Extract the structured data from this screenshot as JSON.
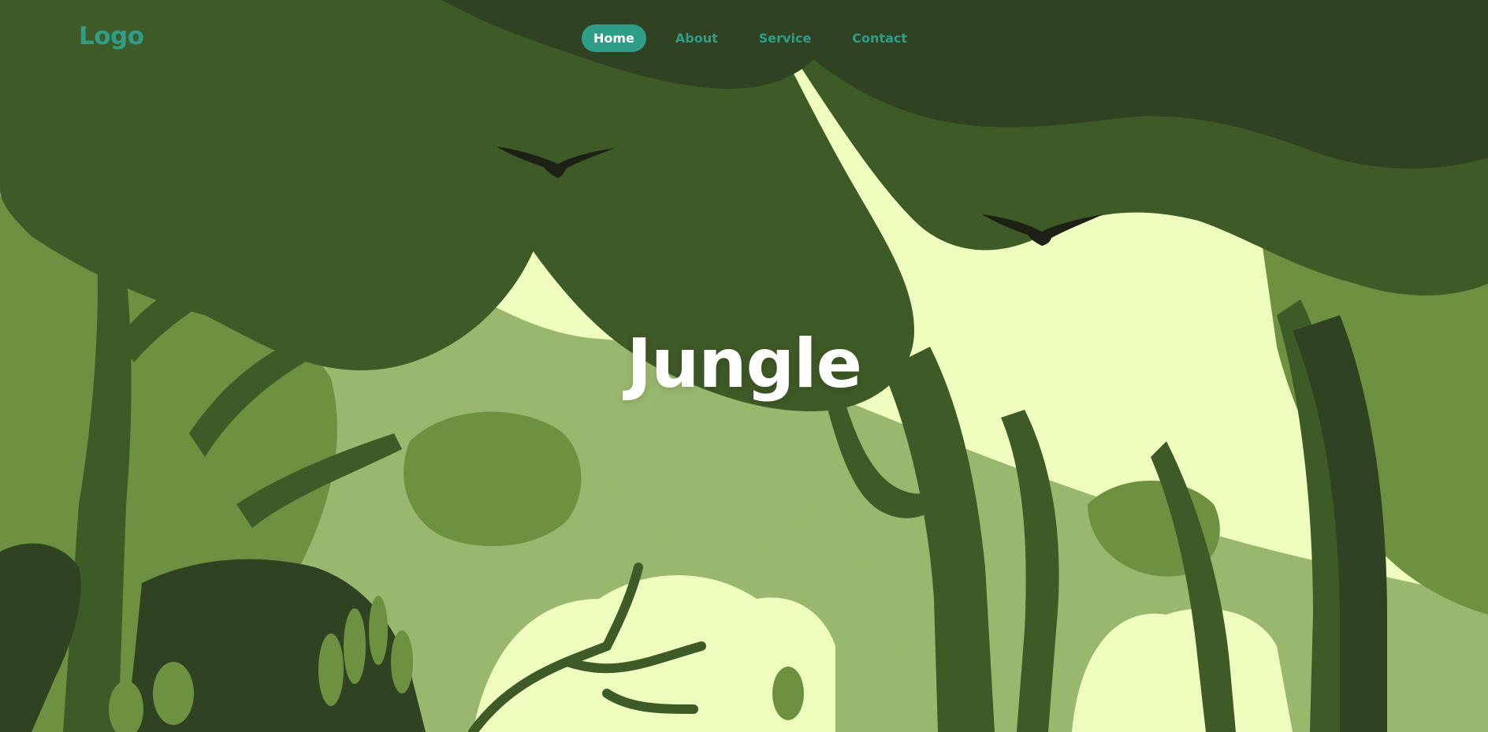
{
  "nav": {
    "logo": "Logo",
    "links": [
      {
        "label": "Home",
        "active": true
      },
      {
        "label": "About",
        "active": false
      },
      {
        "label": "Service",
        "active": false
      },
      {
        "label": "Contact",
        "active": false
      }
    ]
  },
  "hero": {
    "title": "Jungle"
  },
  "theme": {
    "accent": "#2f9e89",
    "sky": "#eefcbd",
    "foliage_light": "#99b86d",
    "foliage_mid": "#6e9141",
    "foliage_dark": "#3e5a26",
    "foliage_darkest": "#2f4222",
    "bird": "#1d2015",
    "title_color": "#ffffff"
  }
}
